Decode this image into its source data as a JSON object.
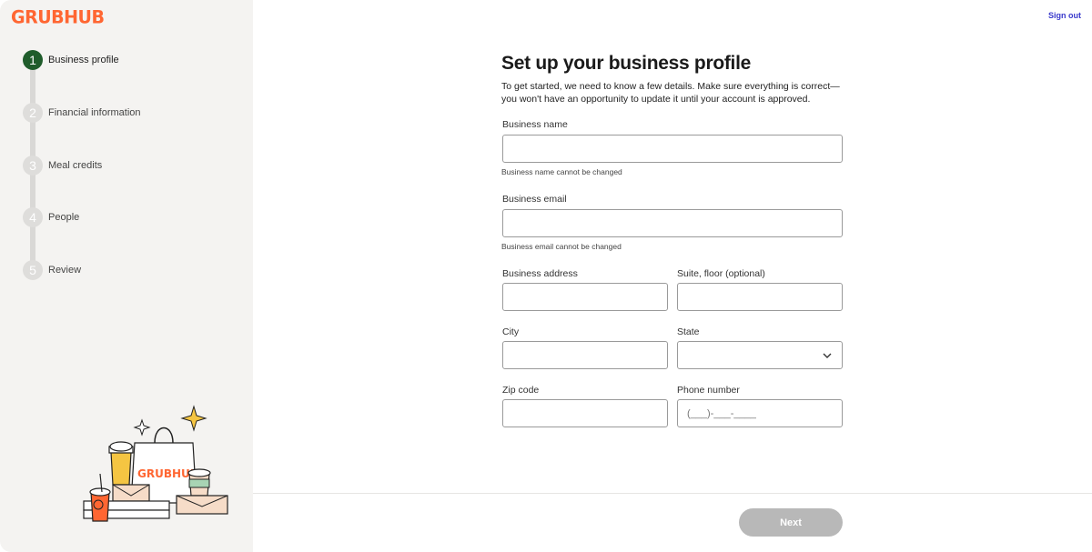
{
  "brand": {
    "logo_text": "GRUBHUB",
    "accent": "#ff6632",
    "step_active_color": "#1f5c2b"
  },
  "header": {
    "sign_out": "Sign out"
  },
  "steps": [
    {
      "num": "1",
      "label": "Business profile",
      "active": true
    },
    {
      "num": "2",
      "label": "Financial information",
      "active": false
    },
    {
      "num": "3",
      "label": "Meal credits",
      "active": false
    },
    {
      "num": "4",
      "label": "People",
      "active": false
    },
    {
      "num": "5",
      "label": "Review",
      "active": false
    }
  ],
  "form": {
    "title": "Set up your business profile",
    "intro": "To get started, we need to know a few details. Make sure everything is correct—you won't have an opportunity to update it until your account is approved.",
    "business_name": {
      "label": "Business name",
      "value": "",
      "hint": "Business name cannot be changed"
    },
    "business_email": {
      "label": "Business email",
      "value": "",
      "hint": "Business email cannot be changed"
    },
    "business_address": {
      "label": "Business address",
      "value": ""
    },
    "suite": {
      "label": "Suite, floor (optional)",
      "value": ""
    },
    "city": {
      "label": "City",
      "value": ""
    },
    "state": {
      "label": "State",
      "value": ""
    },
    "zip": {
      "label": "Zip code",
      "value": ""
    },
    "phone": {
      "label": "Phone number",
      "placeholder": "(___)-___-____"
    }
  },
  "footer": {
    "next_label": "Next"
  },
  "illustration": {
    "bag_text": "GRUBHUB"
  }
}
